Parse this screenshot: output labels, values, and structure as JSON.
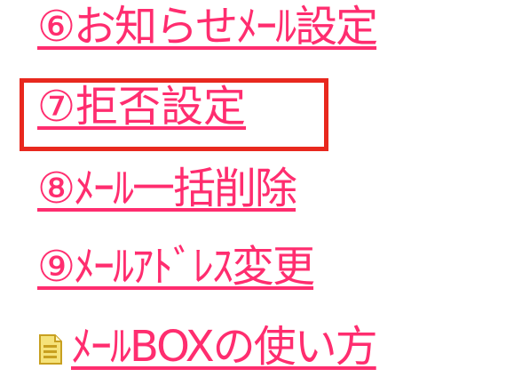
{
  "menu": {
    "items": [
      {
        "id": "item6",
        "label": "⑥お知らせﾒｰﾙ設定"
      },
      {
        "id": "item7",
        "label": "⑦拒否設定"
      },
      {
        "id": "item8",
        "label": "⑧ﾒｰﾙ一括削除"
      },
      {
        "id": "item9",
        "label": "⑨ﾒｰﾙｱﾄﾞﾚｽ変更"
      },
      {
        "id": "item10",
        "label": "ﾒｰﾙBOXの使い方",
        "icon": "document-icon"
      }
    ],
    "highlighted_index": 1
  },
  "colors": {
    "link": "#ff2d6f",
    "highlight_border": "#e8281e",
    "icon_body": "#f5e27a",
    "icon_outline": "#c8a020"
  }
}
